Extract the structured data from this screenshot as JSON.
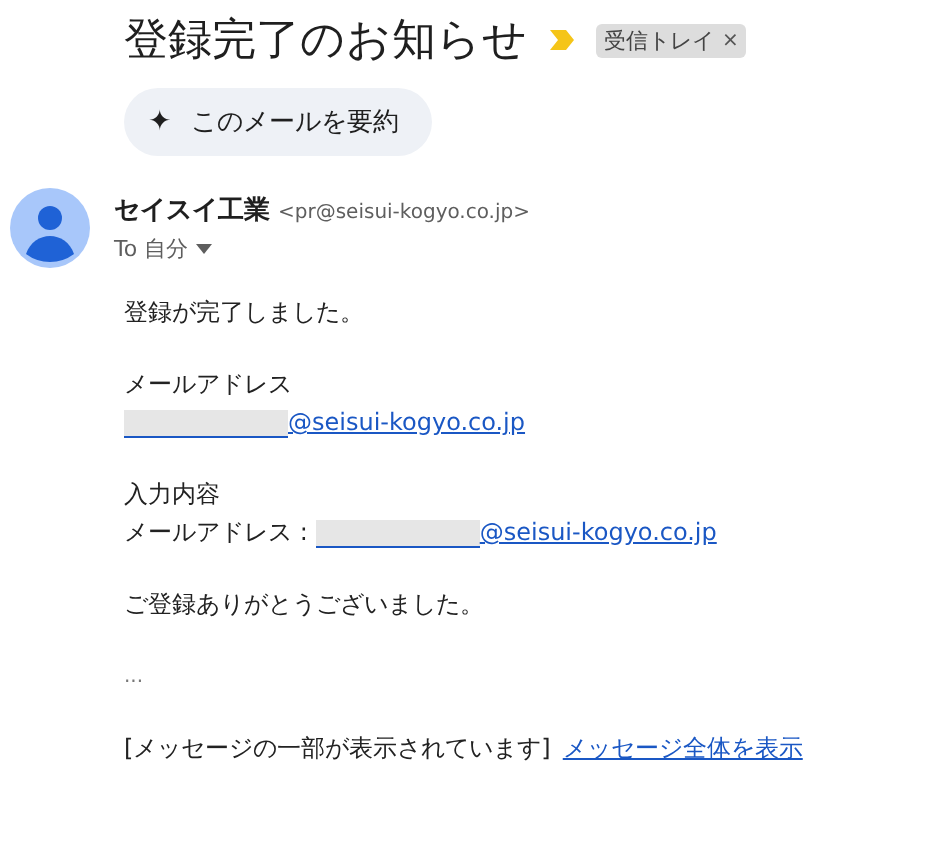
{
  "subject": "登録完了のお知らせ",
  "label_chip": {
    "text": "受信トレイ",
    "close": "×"
  },
  "summarize_button": {
    "icon": "✦",
    "label": "このメールを要約"
  },
  "sender": {
    "name": "セイスイ工業",
    "email": "<pr@seisui-kogyo.co.jp>",
    "to": "To 自分"
  },
  "paragraphs": [
    {
      "lines": [
        {
          "kind": "text",
          "text": "登録が完了しました。"
        }
      ]
    },
    {
      "lines": [
        {
          "kind": "text",
          "text": "メールアドレス"
        },
        {
          "kind": "email",
          "domain": "@seisui-kogyo.co.jp"
        }
      ]
    },
    {
      "lines": [
        {
          "kind": "text",
          "text": "入力内容"
        },
        {
          "kind": "email",
          "prefix": "メールアドレス :",
          "domain": "@seisui-kogyo.co.jp"
        }
      ]
    },
    {
      "lines": [
        {
          "kind": "text",
          "text": "ご登録ありがとうございました。"
        }
      ]
    },
    {
      "lines": [
        {
          "kind": "ellipsis",
          "text": "..."
        }
      ]
    }
  ],
  "clipped_notice": {
    "text": "[メッセージの一部が表示されています]",
    "link": "メッセージ全体を表示"
  }
}
